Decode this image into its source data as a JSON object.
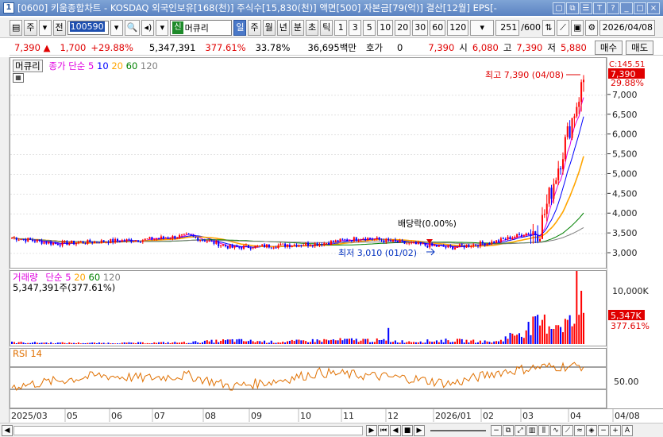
{
  "window": {
    "app_number": "1",
    "title": "[0600] 키움종합차트 - KOSDAQ 외국인보유[168(천)] 주식수[15,830(천)] 액면[500] 자본금[79(억)] 결산[12월] EPS[-"
  },
  "toolbar": {
    "period_type": "주",
    "period_label": "전",
    "stock_code": "100590",
    "stock_tag": "신",
    "stock_name": "머큐리",
    "timeframes": [
      "일",
      "주",
      "월",
      "년",
      "분",
      "초",
      "틱"
    ],
    "active_timeframe": "일",
    "intervals": [
      "1",
      "3",
      "5",
      "10",
      "20",
      "30",
      "60",
      "120"
    ],
    "candle_count": "251",
    "candle_max": "/600",
    "date": "2026/04/08"
  },
  "quote": {
    "price": "7,390",
    "change": "1,700",
    "change_pct": "+29.88%",
    "volume": "5,347,391",
    "volume_pct": "377.61%",
    "turnover_pct": "33.78%",
    "amount": "36,695백만",
    "hoga_label": "호가",
    "hoga_value": "0",
    "price2": "7,390",
    "open_label": "시",
    "open": "6,080",
    "high_label": "고",
    "high": "7,390",
    "low_label": "저",
    "low": "5,880",
    "buy_label": "매수",
    "sell_label": "매도"
  },
  "price_pane": {
    "stock_name": "머큐리",
    "ma_title": "종가 단순",
    "ma_periods": [
      "5",
      "10",
      "20",
      "60",
      "120"
    ],
    "ma_colors": [
      "#e000e0",
      "#0000ff",
      "#ffa500",
      "#008000",
      "#808080"
    ],
    "y_ticks": [
      "7,000",
      "6,500",
      "6,000",
      "5,500",
      "5,000",
      "4,500",
      "4,000",
      "3,500",
      "3,000"
    ],
    "cur_price_label": "7,390",
    "cur_pct_label": "29.88%",
    "top_partial_label": "C:145.51",
    "max_annotation": "최고 7,390 (04/08)",
    "min_annotation": "최저 3,010 (01/02)",
    "dividend_annotation": "배당락(0.00%)"
  },
  "volume_pane": {
    "title": "거래량",
    "ma_title": "단순",
    "ma_periods": [
      "5",
      "20",
      "60",
      "120"
    ],
    "ma_colors": [
      "#e000e0",
      "#ffa500",
      "#008000",
      "#808080"
    ],
    "current": "5,347,391주(377.61%)",
    "y_tick": "10,000K",
    "cur_label": "5,347K",
    "cur_pct_label": "377.61%"
  },
  "rsi_pane": {
    "title": "RSI 14",
    "y_tick": "50.00"
  },
  "x_axis": [
    "2025/03",
    "05",
    "06",
    "07",
    "08",
    "09",
    "10",
    "11",
    "12",
    "2026/01",
    "02",
    "03",
    "04",
    "04/08"
  ],
  "status_bar": {
    "nav_buttons": [
      "◀",
      "▶",
      "⏮",
      "⏭",
      "■",
      "▶"
    ],
    "zoom_buttons": [
      "-",
      "+",
      "A"
    ]
  },
  "chart_data": [
    {
      "type": "line",
      "title": "",
      "x": [
        "2025/03",
        "04",
        "05",
        "06",
        "07",
        "08",
        "09",
        "10",
        "11",
        "12",
        "2026/01",
        "02",
        "03",
        "04/08"
      ],
      "series": [
        {
          "values": [
            3400,
            3250,
            3300,
            3350,
            3450,
            3150,
            3200,
            3250,
            3400,
            3250,
            3150,
            3300,
            3600,
            7390
          ]
        }
      ],
      "ylim": [
        2800,
        7700
      ]
    },
    {
      "type": "bar",
      "title": "거래량",
      "x": [
        "2025/03",
        "04",
        "05",
        "06",
        "07",
        "08",
        "09",
        "10",
        "11",
        "12",
        "2026/01",
        "02",
        "03",
        "04/08"
      ],
      "values": [
        400,
        300,
        250,
        300,
        400,
        900,
        500,
        900,
        1000,
        600,
        900,
        500,
        5000,
        5347
      ],
      "ylabel": "K"
    },
    {
      "type": "line",
      "title": "RSI 14",
      "x": [
        "2025/03",
        "04",
        "05",
        "06",
        "07",
        "08",
        "09",
        "10",
        "11",
        "12",
        "2026/01",
        "02",
        "03",
        "04/08"
      ],
      "series": [
        {
          "name": "RSI 14",
          "values": [
            35,
            45,
            55,
            50,
            55,
            35,
            45,
            60,
            55,
            50,
            40,
            60,
            70,
            72
          ]
        }
      ],
      "ylim": [
        0,
        100
      ]
    }
  ]
}
